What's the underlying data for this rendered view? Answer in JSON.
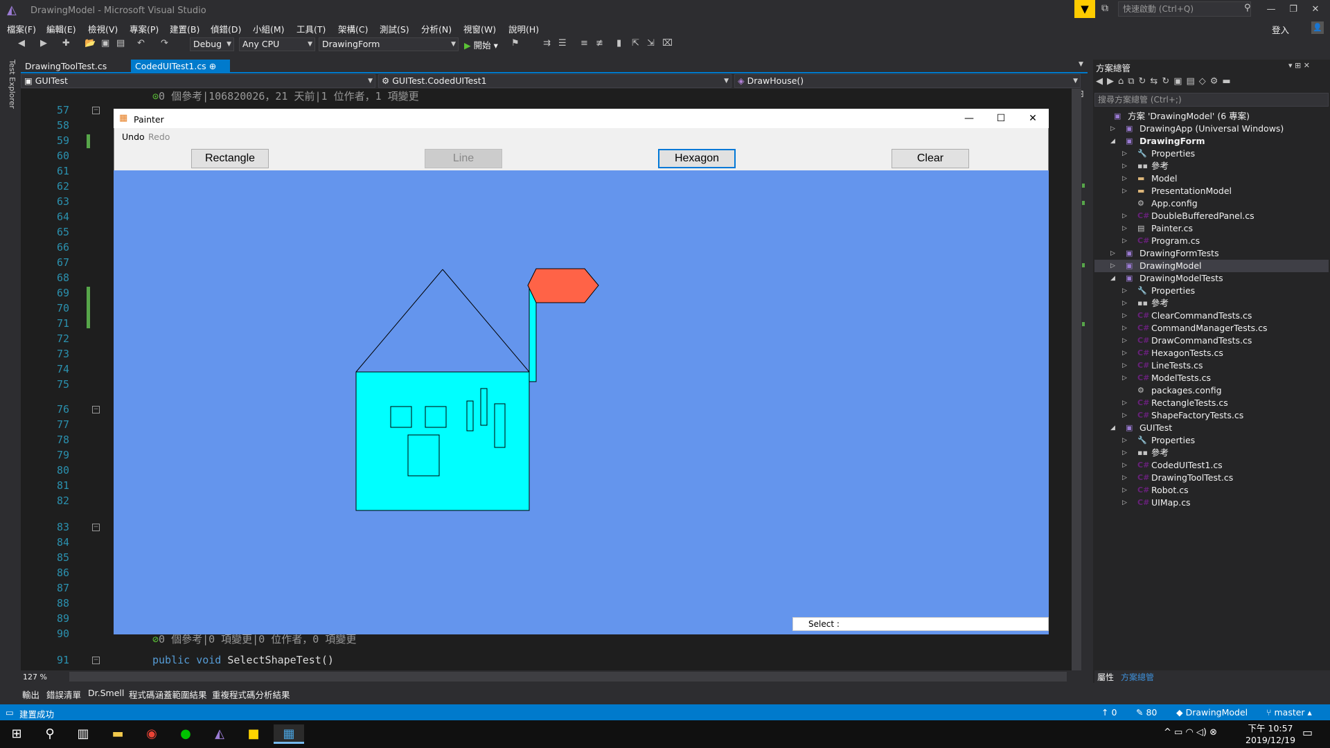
{
  "window": {
    "title": "DrawingModel - Microsoft Visual Studio"
  },
  "quick_launch": {
    "placeholder": "快速啟動 (Ctrl+Q)"
  },
  "account": {
    "login": "登入"
  },
  "menu": [
    "檔案(F)",
    "編輯(E)",
    "檢視(V)",
    "專案(P)",
    "建置(B)",
    "偵錯(D)",
    "小組(M)",
    "工具(T)",
    "架構(C)",
    "測試(S)",
    "分析(N)",
    "視窗(W)",
    "說明(H)"
  ],
  "toolbar": {
    "configuration": "Debug",
    "platform": "Any CPU",
    "startup": "DrawingForm",
    "start_label": "開始"
  },
  "left_rail": {
    "test_explorer": "Test Explorer"
  },
  "tabs": [
    {
      "label": "DrawingToolTest.cs"
    },
    {
      "label": "CodedUITest1.cs"
    }
  ],
  "navbar": {
    "project": "GUITest",
    "class": "GUITest.CodedUITest1",
    "member": "DrawHouse()"
  },
  "editor": {
    "line_numbers": [
      "57",
      "58",
      "59",
      "60",
      "61",
      "62",
      "63",
      "64",
      "65",
      "66",
      "67",
      "68",
      "69",
      "70",
      "71",
      "72",
      "73",
      "74",
      "75",
      "76",
      "77",
      "78",
      "79",
      "80",
      "81",
      "82",
      "83",
      "84",
      "85",
      "86",
      "87",
      "88",
      "89",
      "90",
      "91"
    ],
    "lens_top": "0 個參考|106820026，21 天前|1 位作者，1 項變更",
    "lens_bottom": "0 個參考|0 項變更|0 位作者，0 項變更",
    "code_bottom_kw1": "public",
    "code_bottom_kw2": "void",
    "code_bottom_rest": " SelectShapeTest()",
    "zoom": "127 %"
  },
  "solution_explorer": {
    "title": "方案總管",
    "search_placeholder": "搜尋方案總管 (Ctrl+;)",
    "items": [
      {
        "label": "方案 'DrawingModel' (6 專案)",
        "level": 0,
        "arrow": "",
        "icon": "solution-icon",
        "bold": false
      },
      {
        "label": "DrawingApp (Universal Windows)",
        "level": 1,
        "arrow": "▷",
        "icon": "csproj-icon"
      },
      {
        "label": "DrawingForm",
        "level": 1,
        "arrow": "◢",
        "icon": "csproj-icon",
        "bold": true
      },
      {
        "label": "Properties",
        "level": 2,
        "arrow": "▷",
        "icon": "wrench-icon"
      },
      {
        "label": "參考",
        "level": 2,
        "arrow": "▷",
        "icon": "references-icon"
      },
      {
        "label": "Model",
        "level": 2,
        "arrow": "▷",
        "icon": "folder-icon"
      },
      {
        "label": "PresentationModel",
        "level": 2,
        "arrow": "▷",
        "icon": "folder-icon"
      },
      {
        "label": "App.config",
        "level": 2,
        "arrow": "",
        "icon": "config-icon"
      },
      {
        "label": "DoubleBufferedPanel.cs",
        "level": 2,
        "arrow": "▷",
        "icon": "cs-file-icon"
      },
      {
        "label": "Painter.cs",
        "level": 2,
        "arrow": "▷",
        "icon": "form-icon"
      },
      {
        "label": "Program.cs",
        "level": 2,
        "arrow": "▷",
        "icon": "cs-file-icon"
      },
      {
        "label": "DrawingFormTests",
        "level": 1,
        "arrow": "▷",
        "icon": "csproj-icon"
      },
      {
        "label": "DrawingModel",
        "level": 1,
        "arrow": "▷",
        "icon": "csproj-icon",
        "selected": true
      },
      {
        "label": "DrawingModelTests",
        "level": 1,
        "arrow": "◢",
        "icon": "csproj-icon"
      },
      {
        "label": "Properties",
        "level": 2,
        "arrow": "▷",
        "icon": "wrench-icon"
      },
      {
        "label": "參考",
        "level": 2,
        "arrow": "▷",
        "icon": "references-icon"
      },
      {
        "label": "ClearCommandTests.cs",
        "level": 2,
        "arrow": "▷",
        "icon": "cs-file-icon"
      },
      {
        "label": "CommandManagerTests.cs",
        "level": 2,
        "arrow": "▷",
        "icon": "cs-file-icon"
      },
      {
        "label": "DrawCommandTests.cs",
        "level": 2,
        "arrow": "▷",
        "icon": "cs-file-icon"
      },
      {
        "label": "HexagonTests.cs",
        "level": 2,
        "arrow": "▷",
        "icon": "cs-file-icon"
      },
      {
        "label": "LineTests.cs",
        "level": 2,
        "arrow": "▷",
        "icon": "cs-file-icon"
      },
      {
        "label": "ModelTests.cs",
        "level": 2,
        "arrow": "▷",
        "icon": "cs-file-icon"
      },
      {
        "label": "packages.config",
        "level": 2,
        "arrow": "",
        "icon": "config-icon"
      },
      {
        "label": "RectangleTests.cs",
        "level": 2,
        "arrow": "▷",
        "icon": "cs-file-icon"
      },
      {
        "label": "ShapeFactoryTests.cs",
        "level": 2,
        "arrow": "▷",
        "icon": "cs-file-icon"
      },
      {
        "label": "GUITest",
        "level": 1,
        "arrow": "◢",
        "icon": "csproj-icon"
      },
      {
        "label": "Properties",
        "level": 2,
        "arrow": "▷",
        "icon": "wrench-icon"
      },
      {
        "label": "參考",
        "level": 2,
        "arrow": "▷",
        "icon": "references-icon"
      },
      {
        "label": "CodedUITest1.cs",
        "level": 2,
        "arrow": "▷",
        "icon": "cs-file-icon"
      },
      {
        "label": "DrawingToolTest.cs",
        "level": 2,
        "arrow": "▷",
        "icon": "cs-file-icon"
      },
      {
        "label": "Robot.cs",
        "level": 2,
        "arrow": "▷",
        "icon": "cs-file-icon"
      },
      {
        "label": "UIMap.cs",
        "level": 2,
        "arrow": "▷",
        "icon": "cs-file-icon"
      }
    ],
    "bottom_tabs": [
      "屬性",
      "方案總管"
    ]
  },
  "bottom_tabs": [
    "輸出",
    "錯誤清單",
    "Dr.Smell",
    "程式碼涵蓋範圍結果",
    "重複程式碼分析結果"
  ],
  "statusbar": {
    "message": "建置成功",
    "up_count": "0",
    "pencil_count": "80",
    "repo": "DrawingModel",
    "branch": "master"
  },
  "clock": {
    "time": "下午 10:57",
    "date": "2019/12/19"
  },
  "painter": {
    "title": "Painter",
    "menu": {
      "undo": "Undo",
      "redo": "Redo"
    },
    "buttons": {
      "rectangle": "Rectangle",
      "line": "Line",
      "hexagon": "Hexagon",
      "clear": "Clear"
    },
    "select_label": "Select :",
    "colors": {
      "canvas": "#6495ED",
      "house": "#00FFFF",
      "flag": "#FF6347"
    }
  }
}
